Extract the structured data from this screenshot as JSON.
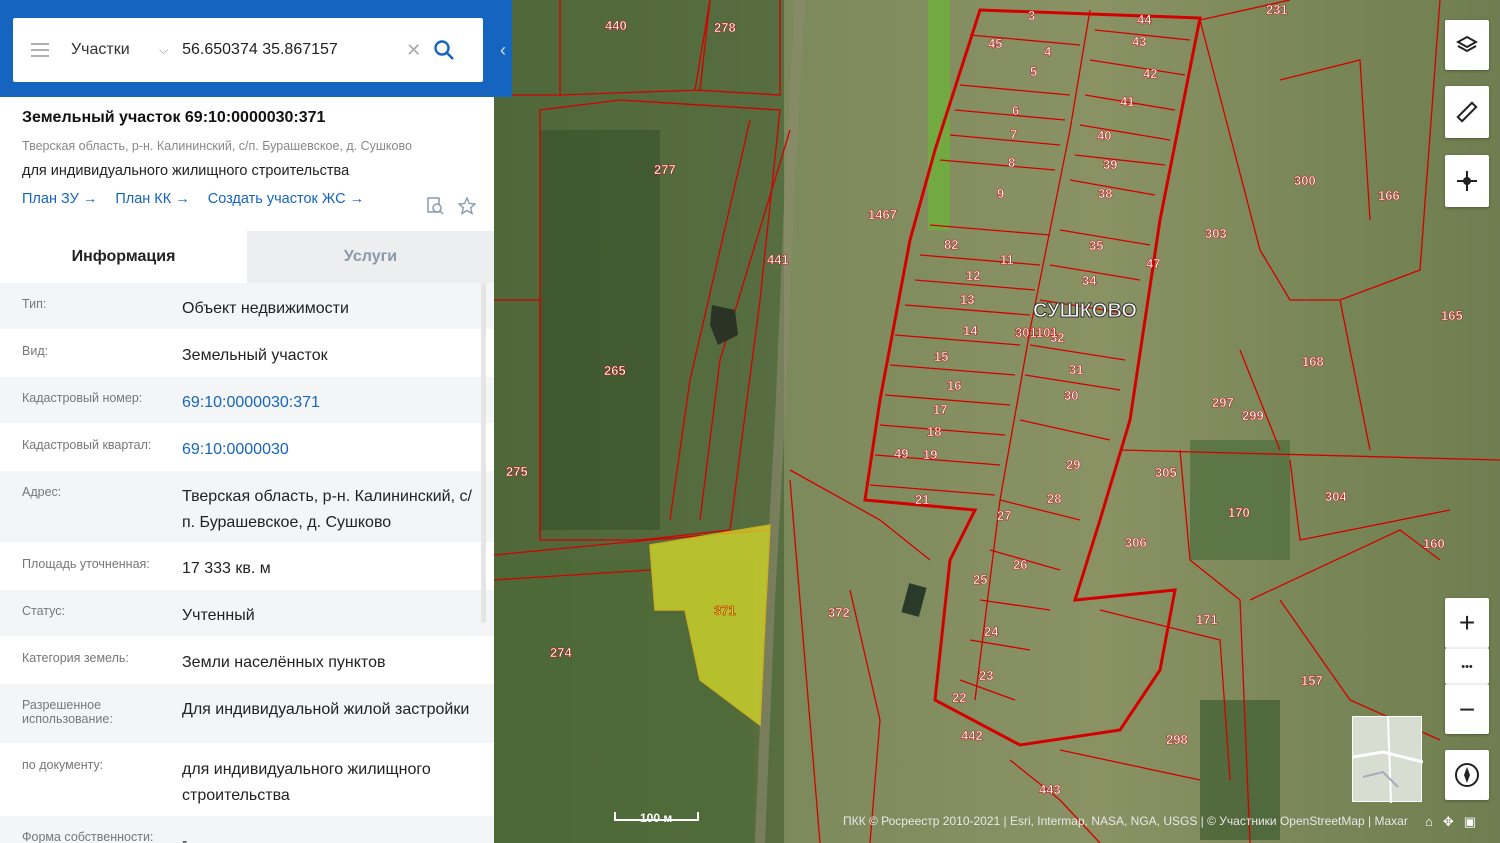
{
  "search": {
    "type_label": "Участки",
    "query": "56.650374 35.867157"
  },
  "object": {
    "title": "Земельный участок 69:10:0000030:371",
    "address_short": "Тверская область, р-н. Калининский, с/п. Бурашевское, д. Сушково",
    "purpose": "для индивидуального жилищного строительства",
    "links": [
      "План ЗУ →",
      "План КК →",
      "Создать участок ЖС →"
    ]
  },
  "tabs": [
    "Информация",
    "Услуги"
  ],
  "info_rows": [
    {
      "label": "Тип:",
      "value": "Объект недвижимости"
    },
    {
      "label": "Вид:",
      "value": "Земельный участок"
    },
    {
      "label": "Кадастровый номер:",
      "value": "69:10:0000030:371"
    },
    {
      "label": "Кадастровый квартал:",
      "value": "69:10:0000030"
    },
    {
      "label": "Адрес:",
      "value": "Тверская область, р-н. Калининский, с/п. Бурашевское, д. Сушково"
    },
    {
      "label": "Площадь уточненная:",
      "value": "17 333 кв. м"
    },
    {
      "label": "Статус:",
      "value": "Учтенный"
    },
    {
      "label": "Категория земель:",
      "value": "Земли населённых пунктов"
    },
    {
      "label": "Разрешенное использование:",
      "value": "Для индивидуальной жилой застройки"
    },
    {
      "label": "по документу:",
      "value": "для индивидуального жилищного строительства"
    },
    {
      "label": "Форма собственности:",
      "value": "-"
    }
  ],
  "map": {
    "village_name": "СУШКОВО",
    "quarter_label": "301101",
    "selected_parcel": "371",
    "parcel_labels": [
      "440",
      "278",
      "231",
      "277",
      "1467",
      "441",
      "265",
      "275",
      "274",
      "372",
      "300",
      "166",
      "303",
      "165",
      "168",
      "299",
      "297",
      "305",
      "304",
      "170",
      "306",
      "160",
      "171",
      "157",
      "298",
      "442",
      "443",
      "3",
      "44",
      "45",
      "4",
      "43",
      "5",
      "42",
      "41",
      "6",
      "40",
      "7",
      "8",
      "39",
      "38",
      "9",
      "82",
      "11",
      "35",
      "12",
      "47",
      "34",
      "13",
      "14",
      "32",
      "15",
      "31",
      "16",
      "30",
      "17",
      "18",
      "49",
      "19",
      "29",
      "28",
      "21",
      "27",
      "26",
      "25",
      "24",
      "23",
      "22"
    ],
    "scale": "100 м",
    "attribution": "ПКК © Росреестр 2010-2021 | Esri, Intermap, NASA, NGA, USGS | © Участники OpenStreetMap | Maxar"
  },
  "controls": {
    "zoom_in": "+",
    "more": "•••",
    "zoom_out": "−"
  },
  "colors": {
    "brand_blue": "#1565c0",
    "parcel_red": "#d40000",
    "selected_yellow": "#d8dc2a"
  }
}
